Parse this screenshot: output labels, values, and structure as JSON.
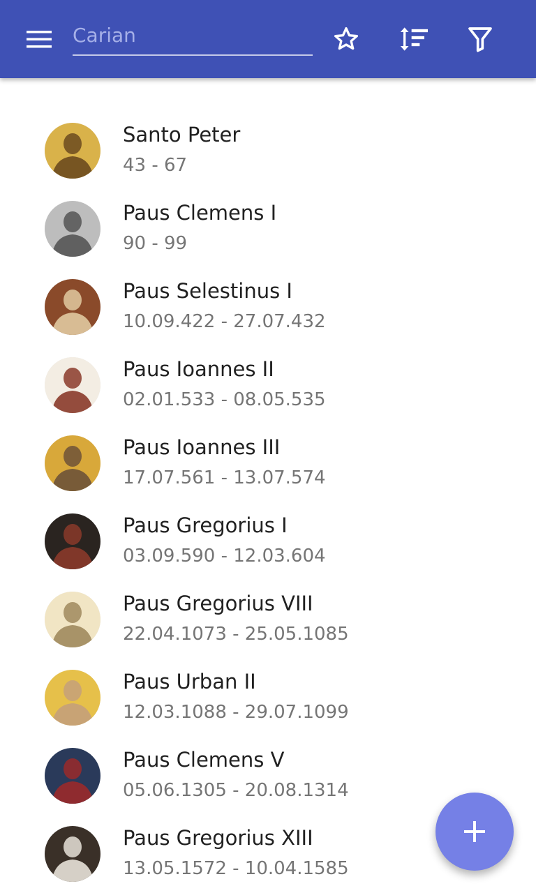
{
  "toolbar": {
    "search_placeholder": "Carian",
    "icons": [
      "menu-icon",
      "star-outline-icon",
      "sort-icon",
      "filter-icon"
    ],
    "background_color": "#3f51b5"
  },
  "popes": [
    {
      "name": "Santo Peter",
      "dates": "43 - 67",
      "portrait_colors": [
        "#d9b24a",
        "#6b4a1e"
      ]
    },
    {
      "name": "Paus Clemens I",
      "dates": "90 - 99",
      "portrait_colors": [
        "#bdbdbd",
        "#555555"
      ]
    },
    {
      "name": "Paus Selestinus I",
      "dates": "10.09.422 - 27.07.432",
      "portrait_colors": [
        "#8a4a2a",
        "#e0c9a0"
      ]
    },
    {
      "name": "Paus Ioannes II",
      "dates": "02.01.533 - 08.05.535",
      "portrait_colors": [
        "#f3ede3",
        "#8a3a2a"
      ]
    },
    {
      "name": "Paus Ioannes III",
      "dates": "17.07.561 - 13.07.574",
      "portrait_colors": [
        "#d8a83a",
        "#6e5238"
      ]
    },
    {
      "name": "Paus Gregorius I",
      "dates": "03.09.590 - 12.03.604",
      "portrait_colors": [
        "#2a2420",
        "#8a3a2a"
      ]
    },
    {
      "name": "Paus Gregorius VIII",
      "dates": "22.04.1073 - 25.05.1085",
      "portrait_colors": [
        "#f1e5c4",
        "#a08a5e"
      ]
    },
    {
      "name": "Paus Urban II",
      "dates": "12.03.1088 - 29.07.1099",
      "portrait_colors": [
        "#e6c04a",
        "#c4a07a"
      ]
    },
    {
      "name": "Paus Clemens V",
      "dates": "05.06.1305 - 20.08.1314",
      "portrait_colors": [
        "#2a3a5a",
        "#9a2a2a"
      ]
    },
    {
      "name": "Paus Gregorius XIII",
      "dates": "13.05.1572 - 10.04.1585",
      "portrait_colors": [
        "#3a3028",
        "#e8e2d8"
      ]
    }
  ],
  "fab": {
    "icon": "plus-icon",
    "color": "#7580e6"
  }
}
